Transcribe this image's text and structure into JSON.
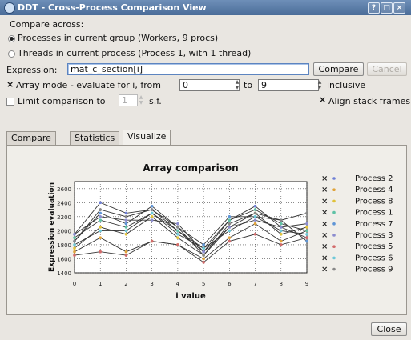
{
  "window": {
    "title": "DDT - Cross-Process Comparison View",
    "buttons": [
      "?",
      "□",
      "×"
    ]
  },
  "compare_across": {
    "label": "Compare across:",
    "options": [
      {
        "label": "Processes in current group (Workers, 9 procs)",
        "selected": true
      },
      {
        "label": "Threads in current process (Process 1, with 1 thread)",
        "selected": false
      }
    ]
  },
  "expression": {
    "label": "Expression:",
    "value": "mat_c_section[i]",
    "compare_label": "Compare",
    "cancel_label": "Cancel"
  },
  "array_mode": {
    "checked": true,
    "label": "Array mode - evaluate for i, from",
    "from": "0",
    "to_label": "to",
    "to": "9",
    "inclusive": "inclusive"
  },
  "limit": {
    "checked": false,
    "label": "Limit comparison to",
    "value": "1",
    "suffix": "s.f."
  },
  "align_stack": {
    "checked": true,
    "label": "Align stack frames"
  },
  "tabs": [
    "Compare",
    "Statistics",
    "Visualize"
  ],
  "active_tab": "Visualize",
  "close_label": "Close",
  "chart_data": {
    "type": "line",
    "title": "Array comparison",
    "xlabel": "i value",
    "ylabel": "Expression evaluation",
    "x": [
      0,
      1,
      2,
      3,
      4,
      5,
      6,
      7,
      8,
      9
    ],
    "xticks": [
      "0",
      "1",
      "2",
      "3",
      "4",
      "5",
      "6",
      "7",
      "8",
      "9"
    ],
    "yticks": [
      "1400",
      "1600",
      "1800",
      "2000",
      "2200",
      "2400",
      "2600"
    ],
    "ylim": [
      1400,
      2700
    ],
    "grid": true,
    "legend_position": "right",
    "series": [
      {
        "name": "Process 2",
        "color": "#6e7fd6",
        "values": [
          1950,
          2400,
          2250,
          2300,
          2000,
          1700,
          2150,
          2350,
          2050,
          1900
        ]
      },
      {
        "name": "Process 4",
        "color": "#e0a33a",
        "values": [
          1700,
          1900,
          1700,
          1850,
          1800,
          1600,
          1900,
          2100,
          1850,
          2000
        ]
      },
      {
        "name": "Process 8",
        "color": "#e0c23a",
        "values": [
          1750,
          2050,
          1950,
          2200,
          1900,
          1650,
          2050,
          2250,
          1950,
          2050
        ]
      },
      {
        "name": "Process 1",
        "color": "#5fc2a6",
        "values": [
          1900,
          2150,
          2050,
          2250,
          2000,
          1750,
          2150,
          2300,
          2100,
          2000
        ]
      },
      {
        "name": "Process 7",
        "color": "#5f95d6",
        "values": [
          1850,
          2250,
          2100,
          2350,
          2050,
          1800,
          2200,
          2200,
          2150,
          1850
        ]
      },
      {
        "name": "Process 3",
        "color": "#8c8ccf",
        "values": [
          1950,
          2200,
          2150,
          2150,
          2100,
          1700,
          2050,
          2150,
          2050,
          2100
        ]
      },
      {
        "name": "Process 5",
        "color": "#d26a6a",
        "values": [
          1650,
          1700,
          1650,
          1850,
          1800,
          1550,
          1850,
          1950,
          1800,
          1900
        ]
      },
      {
        "name": "Process 6",
        "color": "#6ec8d8",
        "values": [
          1800,
          2000,
          2000,
          2250,
          1950,
          1750,
          2000,
          2200,
          2000,
          1950
        ]
      },
      {
        "name": "Process 9",
        "color": "#888888",
        "values": [
          1850,
          2300,
          2200,
          2300,
          2050,
          1650,
          2100,
          2250,
          2150,
          2250
        ]
      }
    ]
  }
}
